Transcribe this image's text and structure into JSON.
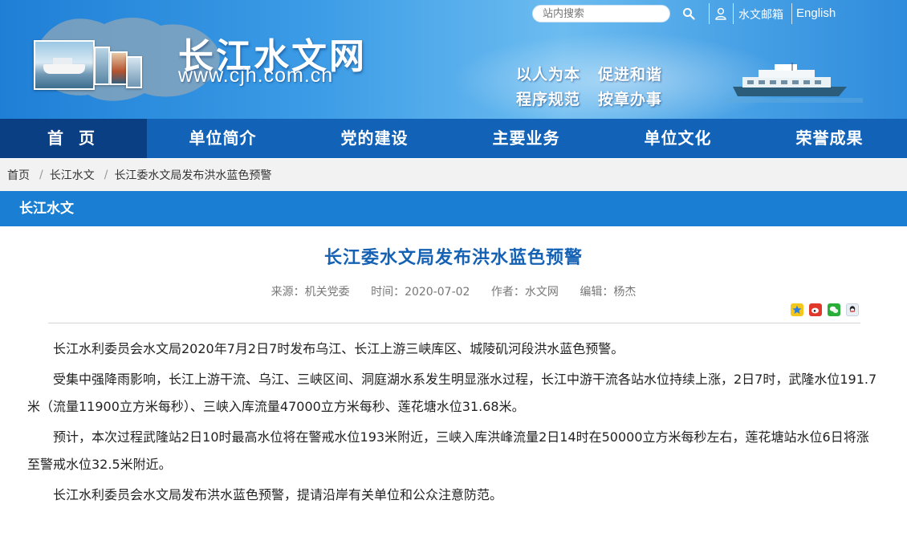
{
  "header": {
    "site_title": "长江水文网",
    "site_url": "www.cjh.com.cn",
    "slogans": [
      "以人为本",
      "促进和谐",
      "程序规范",
      "按章办事"
    ],
    "search_placeholder": "站内搜索",
    "search_icon": "search-icon",
    "user_icon": "user-icon",
    "mail_link": "水文邮箱",
    "english_link": "English"
  },
  "nav": {
    "items": [
      "首 页",
      "单位简介",
      "党的建设",
      "主要业务",
      "单位文化",
      "荣誉成果"
    ],
    "active_index": 0
  },
  "breadcrumb": {
    "items": [
      "首页",
      "长江水文",
      "长江委水文局发布洪水蓝色预警"
    ],
    "separator": "/"
  },
  "section": {
    "title": "长江水文"
  },
  "article": {
    "title": "长江委水文局发布洪水蓝色预警",
    "meta": {
      "source": "来源：机关党委",
      "time": "时间：2020-07-02",
      "author": "作者：水文网",
      "editor": "编辑：杨杰"
    },
    "share_icons": [
      "qzone-icon",
      "weibo-icon",
      "wechat-icon",
      "qq-icon"
    ],
    "paragraphs": [
      "长江水利委员会水文局2020年7月2日7时发布乌江、长江上游三峡库区、城陵矶河段洪水蓝色预警。",
      "受集中强降雨影响，长江上游干流、乌江、三峡区间、洞庭湖水系发生明显涨水过程，长江中游干流各站水位持续上涨，2日7时，武隆水位191.7米（流量11900立方米每秒）、三峡入库流量47000立方米每秒、莲花塘水位31.68米。",
      "预计，本次过程武隆站2日10时最高水位将在警戒水位193米附近，三峡入库洪峰流量2日14时在50000立方米每秒左右，莲花塘站水位6日将涨至警戒水位32.5米附近。",
      "长江水利委员会水文局发布洪水蓝色预警，提请沿岸有关单位和公众注意防范。"
    ]
  },
  "colors": {
    "nav_bg": "#1262b7",
    "nav_active": "#0b3f84",
    "section_bar": "#1a7fd3",
    "title_blue": "#1561b4"
  }
}
